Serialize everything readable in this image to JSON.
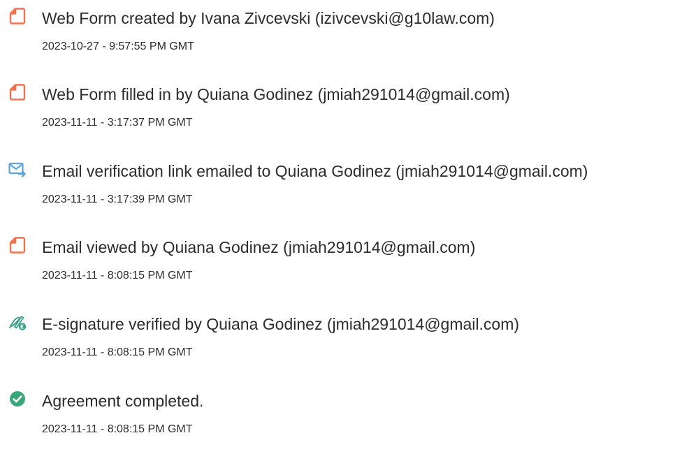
{
  "events": [
    {
      "icon": "document-icon",
      "description": "Web Form created by Ivana Zivcevski (izivcevski@g10law.com)",
      "timestamp": "2023-10-27 - 9:57:55 PM GMT"
    },
    {
      "icon": "document-icon",
      "description": "Web Form filled in by Quiana Godinez (jmiah291014@gmail.com)",
      "timestamp": "2023-11-11 - 3:17:37 PM GMT"
    },
    {
      "icon": "email-send-icon",
      "description": "Email verification link emailed to Quiana Godinez (jmiah291014@gmail.com)",
      "timestamp": "2023-11-11 - 3:17:39 PM GMT"
    },
    {
      "icon": "document-icon",
      "description": "Email viewed by Quiana Godinez (jmiah291014@gmail.com)",
      "timestamp": "2023-11-11 - 8:08:15 PM GMT"
    },
    {
      "icon": "signature-verified-icon",
      "description": "E-signature verified by Quiana Godinez (jmiah291014@gmail.com)",
      "timestamp": "2023-11-11 - 8:08:15 PM GMT"
    },
    {
      "icon": "check-circle-icon",
      "description": "Agreement completed.",
      "timestamp": "2023-11-11 - 8:08:15 PM GMT"
    }
  ],
  "colors": {
    "document_icon": "#f2734f",
    "email_icon": "#5aa6dc",
    "signature_icon": "#3fa08a",
    "check_icon": "#3aa77a"
  }
}
